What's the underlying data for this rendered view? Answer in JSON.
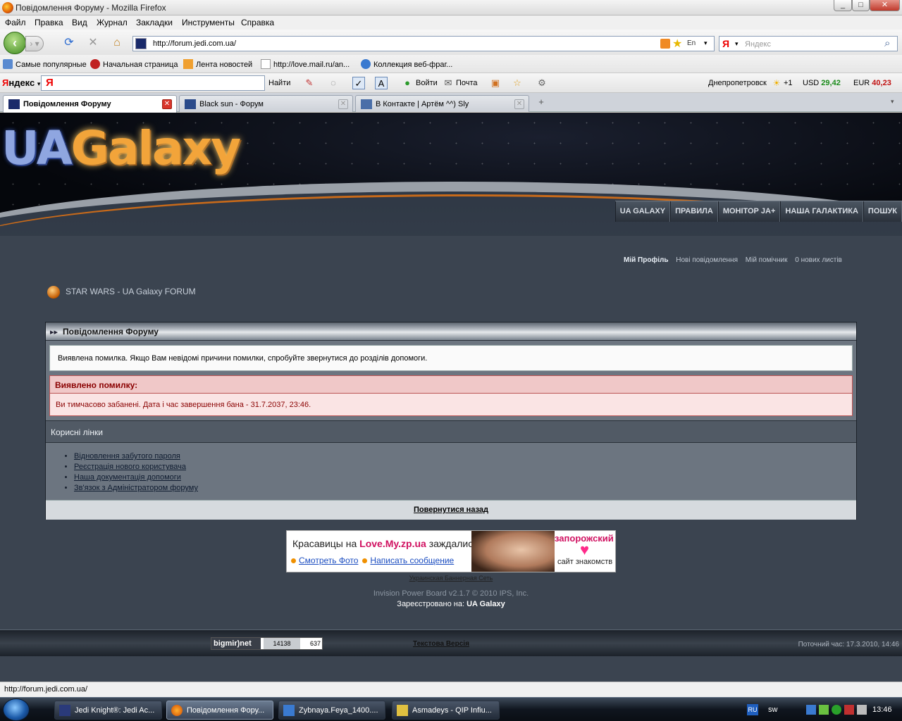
{
  "window": {
    "title": "Повідомлення Форуму - Mozilla Firefox",
    "controls": {
      "minimize": "_",
      "maximize": "□",
      "close": "✕"
    }
  },
  "menu": [
    "Файл",
    "Правка",
    "Вид",
    "Журнал",
    "Закладки",
    "Инструменты",
    "Справка"
  ],
  "nav": {
    "url": "http://forum.jedi.com.ua/",
    "lang_indicator": "En",
    "search_logo": "Я",
    "search_placeholder": "Яндекс"
  },
  "bookmarks": [
    "Самые популярные",
    "Начальная страница",
    "Лента новостей",
    "http://love.mail.ru/an...",
    "Коллекция веб-фраг..."
  ],
  "yandex_bar": {
    "logo_prefix": "Я",
    "logo_rest": "ндекс",
    "input_logo": "Я",
    "find": "Найти",
    "login": "Войти",
    "mail": "Почта",
    "city": "Днепропетровск",
    "temp": "+1",
    "usd_label": "USD",
    "usd_value": "29,42",
    "eur_label": "EUR",
    "eur_value": "40,23"
  },
  "tabs": [
    {
      "label": "Повідомлення Форуму",
      "active": true
    },
    {
      "label": "Black sun - Форум",
      "active": false
    },
    {
      "label": "В Контакте | Артём ^^) Sly",
      "active": false
    }
  ],
  "site": {
    "logo_ua": "UA",
    "logo_galaxy": "Galaxy",
    "top_nav": [
      "UA GALAXY",
      "ПРАВИЛА",
      "МОНІТОР JA+",
      "НАША ГАЛАКТИКА",
      "ПОШУК"
    ],
    "user_links": {
      "profile": "Мій Профіль",
      "new_posts": "Нові повідомлення",
      "assistant": "Мій помічник",
      "messages": "0 нових листів"
    },
    "breadcrumb": "STAR WARS - UA Galaxy FORUM"
  },
  "panel": {
    "title": "Повідомлення Форуму",
    "info": "Виявлена помилка. Якщо Вам невідомі причини помилки, спробуйте звернутися до розділів допомоги.",
    "error_title": "Виявлено помилку:",
    "error_text": "Ви тимчасово забанені. Дата і час завершення бана - 31.7.2037, 23:46.",
    "links_title": "Корисні лінки",
    "links": [
      "Відновлення забутого пароля",
      "Реєстрація нового користувача",
      "Наша документація допомоги",
      "Зв'язок з Адміністратором форуму"
    ],
    "back": "Повернутися назад"
  },
  "ad": {
    "line1_pre": "Красавицы на",
    "line1_site": "Love.My.zp.ua",
    "line1_post": "заждались!!!",
    "link1": "Смотреть Фото",
    "link2": "Написать сообщение",
    "right1": "запорожский",
    "right2": "сайт знакомств",
    "network": "Украинская Баннерная Сеть"
  },
  "footer": {
    "copyright": "Invision Power Board v2.1.7 © 2010  IPS, Inc.",
    "registered_label": "Зареєстровано на:",
    "registered_name": "UA Galaxy",
    "counter_brand": "bigmir)net",
    "counter_1": "14138",
    "counter_2": "637",
    "text_version": "Текстова Версія",
    "current_time": "Поточний час: 17.3.2010, 14:46"
  },
  "status": "http://forum.jedi.com.ua/",
  "taskbar": {
    "items": [
      {
        "label": "Jedi Knight®: Jedi Ac...",
        "active": false
      },
      {
        "label": "Повідомлення Фору...",
        "active": true
      },
      {
        "label": "Zybnaya.Feya_1400....",
        "active": false
      },
      {
        "label": "Asmadeys - QIP Infiu...",
        "active": false
      }
    ],
    "lang": "RU",
    "user": "sw",
    "clock": "13:46"
  }
}
